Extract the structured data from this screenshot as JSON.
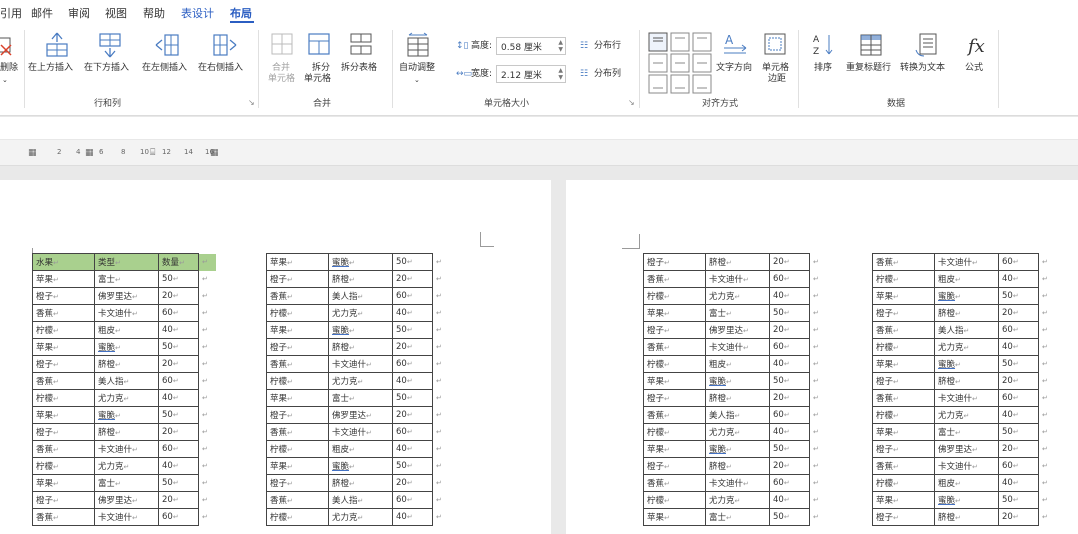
{
  "menu": {
    "items": [
      "引用",
      "邮件",
      "审阅",
      "视图",
      "帮助",
      "表设计",
      "布局"
    ],
    "accent_item": "表设计",
    "active_item": "布局"
  },
  "ribbon": {
    "partial_button": "删除",
    "rows_cols": {
      "insert_above": "在上方插入",
      "insert_below": "在下方插入",
      "insert_left": "在左侧插入",
      "insert_right": "在右侧插入",
      "group_label": "行和列"
    },
    "merge": {
      "merge_cells_line1": "合并",
      "merge_cells_line2": "单元格",
      "split_cells_line1": "拆分",
      "split_cells_line2": "单元格",
      "split_table": "拆分表格",
      "group_label": "合并"
    },
    "cell_size": {
      "autofit": "自动调整",
      "height_label": "高度:",
      "height_value": "0.58 厘米",
      "width_label": "宽度:",
      "width_value": "2.12 厘米",
      "distribute_rows": "分布行",
      "distribute_cols": "分布列",
      "group_label": "单元格大小"
    },
    "alignment": {
      "text_direction": "文字方向",
      "cell_margins_line1": "单元格",
      "cell_margins_line2": "边距",
      "group_label": "对齐方式"
    },
    "data": {
      "sort": "排序",
      "repeat_header": "重复标题行",
      "convert_to_text": "转换为文本",
      "formula": "公式",
      "group_label": "数据"
    }
  },
  "ruler": {
    "marks": [
      "2",
      "4",
      "6",
      "8",
      "10",
      "12",
      "14",
      "16"
    ]
  },
  "tables": {
    "t1": {
      "header": [
        "水果",
        "类型",
        "数量"
      ],
      "rows": [
        [
          "苹果",
          "富士",
          "50"
        ],
        [
          "橙子",
          "佛罗里达",
          "20"
        ],
        [
          "香蕉",
          "卡文迪什",
          "60"
        ],
        [
          "柠檬",
          "粗皮",
          "40"
        ],
        [
          "苹果",
          "蜜脆",
          "50"
        ],
        [
          "橙子",
          "脐橙",
          "20"
        ],
        [
          "香蕉",
          "美人指",
          "60"
        ],
        [
          "柠檬",
          "尤力克",
          "40"
        ],
        [
          "苹果",
          "蜜脆",
          "50"
        ],
        [
          "橙子",
          "脐橙",
          "20"
        ],
        [
          "香蕉",
          "卡文迪什",
          "60"
        ],
        [
          "柠檬",
          "尤力克",
          "40"
        ],
        [
          "苹果",
          "富士",
          "50"
        ],
        [
          "橙子",
          "佛罗里达",
          "20"
        ],
        [
          "香蕉",
          "卡文迪什",
          "60"
        ]
      ]
    },
    "t2": {
      "rows": [
        [
          "苹果",
          "蜜脆",
          "50"
        ],
        [
          "橙子",
          "脐橙",
          "20"
        ],
        [
          "香蕉",
          "美人指",
          "60"
        ],
        [
          "柠檬",
          "尤力克",
          "40"
        ],
        [
          "苹果",
          "蜜脆",
          "50"
        ],
        [
          "橙子",
          "脐橙",
          "20"
        ],
        [
          "香蕉",
          "卡文迪什",
          "60"
        ],
        [
          "柠檬",
          "尤力克",
          "40"
        ],
        [
          "苹果",
          "富士",
          "50"
        ],
        [
          "橙子",
          "佛罗里达",
          "20"
        ],
        [
          "香蕉",
          "卡文迪什",
          "60"
        ],
        [
          "柠檬",
          "粗皮",
          "40"
        ],
        [
          "苹果",
          "蜜脆",
          "50"
        ],
        [
          "橙子",
          "脐橙",
          "20"
        ],
        [
          "香蕉",
          "美人指",
          "60"
        ],
        [
          "柠檬",
          "尤力克",
          "40"
        ]
      ]
    },
    "t3": {
      "rows": [
        [
          "橙子",
          "脐橙",
          "20"
        ],
        [
          "香蕉",
          "卡文迪什",
          "60"
        ],
        [
          "柠檬",
          "尤力克",
          "40"
        ],
        [
          "苹果",
          "富士",
          "50"
        ],
        [
          "橙子",
          "佛罗里达",
          "20"
        ],
        [
          "香蕉",
          "卡文迪什",
          "60"
        ],
        [
          "柠檬",
          "粗皮",
          "40"
        ],
        [
          "苹果",
          "蜜脆",
          "50"
        ],
        [
          "橙子",
          "脐橙",
          "20"
        ],
        [
          "香蕉",
          "美人指",
          "60"
        ],
        [
          "柠檬",
          "尤力克",
          "40"
        ],
        [
          "苹果",
          "蜜脆",
          "50"
        ],
        [
          "橙子",
          "脐橙",
          "20"
        ],
        [
          "香蕉",
          "卡文迪什",
          "60"
        ],
        [
          "柠檬",
          "尤力克",
          "40"
        ],
        [
          "苹果",
          "富士",
          "50"
        ]
      ]
    },
    "t4": {
      "rows": [
        [
          "香蕉",
          "卡文迪什",
          "60"
        ],
        [
          "柠檬",
          "粗皮",
          "40"
        ],
        [
          "苹果",
          "蜜脆",
          "50"
        ],
        [
          "橙子",
          "脐橙",
          "20"
        ],
        [
          "香蕉",
          "美人指",
          "60"
        ],
        [
          "柠檬",
          "尤力克",
          "40"
        ],
        [
          "苹果",
          "蜜脆",
          "50"
        ],
        [
          "橙子",
          "脐橙",
          "20"
        ],
        [
          "香蕉",
          "卡文迪什",
          "60"
        ],
        [
          "柠檬",
          "尤力克",
          "40"
        ],
        [
          "苹果",
          "富士",
          "50"
        ],
        [
          "橙子",
          "佛罗里达",
          "20"
        ],
        [
          "香蕉",
          "卡文迪什",
          "60"
        ],
        [
          "柠檬",
          "粗皮",
          "40"
        ],
        [
          "苹果",
          "蜜脆",
          "50"
        ],
        [
          "橙子",
          "脐橙",
          "20"
        ]
      ]
    }
  },
  "marks": {
    "cell_end": "↵"
  },
  "colors": {
    "accent": "#2b5ec2",
    "header_fill": "#a9d08e"
  }
}
